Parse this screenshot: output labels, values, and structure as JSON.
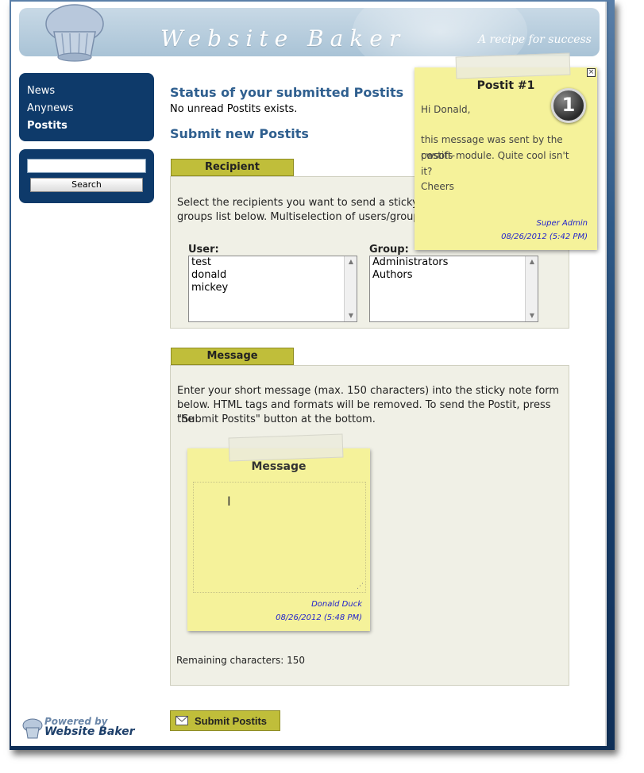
{
  "header": {
    "site_title": "Website Baker",
    "tagline": "A recipe for success"
  },
  "sidebar": {
    "nav": [
      {
        "label": "News",
        "active": false
      },
      {
        "label": "Anynews",
        "active": false
      },
      {
        "label": "Postits",
        "active": true
      }
    ],
    "search_button": "Search",
    "search_value": ""
  },
  "main": {
    "status_heading": "Status of your submitted Postits",
    "no_unread": "No unread Postits exists.",
    "submit_heading": "Submit new Postits",
    "recipient_tab": "Recipient",
    "recipient_text_1": "Select the recipients you want to send a sticky no",
    "recipient_text_2": "groups list below. Multiselection of users/groups",
    "user_label": "User:",
    "group_label": "Group:",
    "users": [
      "test",
      "donald",
      "mickey"
    ],
    "groups": [
      "Administrators",
      "Authors"
    ],
    "message_tab": "Message",
    "message_text_1": "Enter your short message (max. 150 characters) into the sticky note form",
    "message_text_2": "below. HTML tags and formats will be removed. To send the Postit, press the",
    "message_text_3": "\"Submit Postits\" button at the bottom.",
    "note_title": "Message",
    "note_author": "Donald Duck",
    "note_date": "08/26/2012 (5:48 PM)",
    "remaining": "Remaining characters: 150",
    "submit_label": "Submit Postits"
  },
  "popup": {
    "title": "Postit #1",
    "number": "1",
    "greeting": "Hi Donald,",
    "body_1": "this message was sent by the cwsoft-",
    "body_2": "postits module. Quite cool isn't it?",
    "closing": "Cheers",
    "author": "Super Admin",
    "date": "08/26/2012 (5:42 PM)"
  },
  "footer": {
    "powered_by": "Powered by",
    "brand": "Website Baker"
  },
  "colors": {
    "nav_bg": "#0e3a6a",
    "heading": "#2f5f8f",
    "tab": "#c0be3a",
    "sticky": "#f5f29a",
    "signature": "#2222cc"
  }
}
